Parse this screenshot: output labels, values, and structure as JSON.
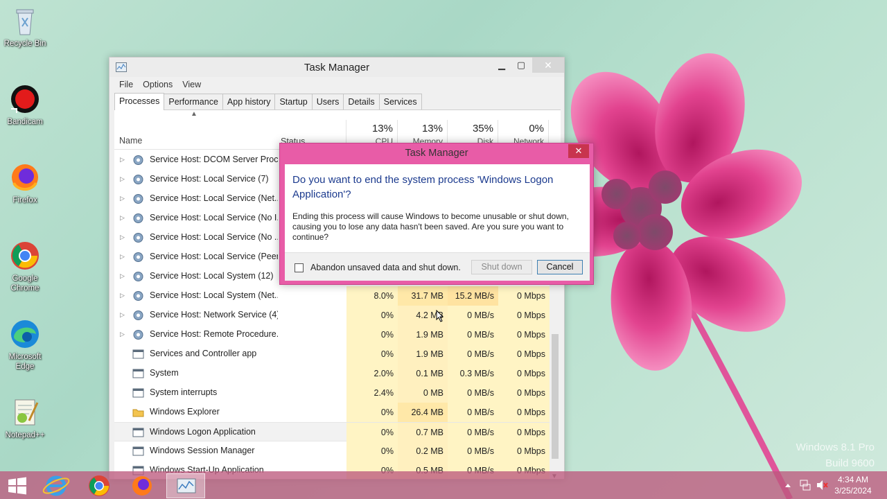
{
  "desktop": {
    "icons": [
      {
        "label": "Recycle Bin"
      },
      {
        "label": "Bandicam"
      },
      {
        "label": "Firefox"
      },
      {
        "label": "Google Chrome"
      },
      {
        "label": "Microsoft Edge"
      },
      {
        "label": "Notepad++"
      }
    ],
    "watermark_line1": "Windows 8.1 Pro",
    "watermark_line2": "Build 9600"
  },
  "task_manager": {
    "title": "Task Manager",
    "menu": [
      "File",
      "Options",
      "View"
    ],
    "tabs": [
      "Processes",
      "Performance",
      "App history",
      "Startup",
      "Users",
      "Details",
      "Services"
    ],
    "active_tab": "Processes",
    "headers": {
      "name": "Name",
      "status": "Status",
      "cpu_pct": "13%",
      "cpu": "CPU",
      "memory_pct": "13%",
      "memory": "Memory",
      "disk_pct": "35%",
      "disk": "Disk",
      "network_pct": "0%",
      "network": "Network"
    },
    "rows": [
      {
        "name": "Service Host: DCOM Server Proc...",
        "cpu": "",
        "memory": "",
        "disk": "",
        "network": ""
      },
      {
        "name": "Service Host: Local Service (7)",
        "cpu": "",
        "memory": "",
        "disk": "",
        "network": ""
      },
      {
        "name": "Service Host: Local Service (Net...",
        "cpu": "",
        "memory": "",
        "disk": "",
        "network": ""
      },
      {
        "name": "Service Host: Local Service (No I...",
        "cpu": "",
        "memory": "",
        "disk": "",
        "network": ""
      },
      {
        "name": "Service Host: Local Service (No ...",
        "cpu": "",
        "memory": "",
        "disk": "",
        "network": ""
      },
      {
        "name": "Service Host: Local Service (Peer...",
        "cpu": "",
        "memory": "",
        "disk": "",
        "network": ""
      },
      {
        "name": "Service Host: Local System (12)",
        "cpu": "",
        "memory": "",
        "disk": "",
        "network": ""
      },
      {
        "name": "Service Host: Local System (Net...",
        "cpu": "8.0%",
        "memory": "31.7 MB",
        "disk": "15.2 MB/s",
        "network": "0 Mbps"
      },
      {
        "name": "Service Host: Network Service (4)",
        "cpu": "0%",
        "memory": "4.2 MB",
        "disk": "0 MB/s",
        "network": "0 Mbps"
      },
      {
        "name": "Service Host: Remote Procedure...",
        "cpu": "0%",
        "memory": "1.9 MB",
        "disk": "0 MB/s",
        "network": "0 Mbps"
      },
      {
        "name": "Services and Controller app",
        "cpu": "0%",
        "memory": "1.9 MB",
        "disk": "0 MB/s",
        "network": "0 Mbps"
      },
      {
        "name": "System",
        "cpu": "2.0%",
        "memory": "0.1 MB",
        "disk": "0.3 MB/s",
        "network": "0 Mbps"
      },
      {
        "name": "System interrupts",
        "cpu": "2.4%",
        "memory": "0 MB",
        "disk": "0 MB/s",
        "network": "0 Mbps"
      },
      {
        "name": "Windows Explorer",
        "cpu": "0%",
        "memory": "26.4 MB",
        "disk": "0 MB/s",
        "network": "0 Mbps"
      },
      {
        "name": "Windows Logon Application",
        "cpu": "0%",
        "memory": "0.7 MB",
        "disk": "0 MB/s",
        "network": "0 Mbps"
      },
      {
        "name": "Windows Session Manager",
        "cpu": "0%",
        "memory": "0.2 MB",
        "disk": "0 MB/s",
        "network": "0 Mbps"
      },
      {
        "name": "Windows Start-Up Application",
        "cpu": "0%",
        "memory": "0.5 MB",
        "disk": "0 MB/s",
        "network": "0 Mbps"
      }
    ]
  },
  "dialog": {
    "title": "Task Manager",
    "close": "✕",
    "question": "Do you want to end the system process 'Windows Logon Application'?",
    "message": "Ending this process will cause Windows to become unusable or shut down, causing you to lose any data hasn't been saved. Are you sure you want to continue?",
    "checkbox_label": "Abandon unsaved data and shut down.",
    "checkbox_checked": false,
    "shutdown_label": "Shut down",
    "cancel_label": "Cancel"
  },
  "taskbar": {
    "time": "4:34 AM",
    "date": "3/25/2024"
  },
  "colors": {
    "accent_dialog": "#e85ca7",
    "taskbar": "#bc5a7e",
    "heat_cell": "#fff4c4",
    "question_text": "#1b3a8e"
  }
}
